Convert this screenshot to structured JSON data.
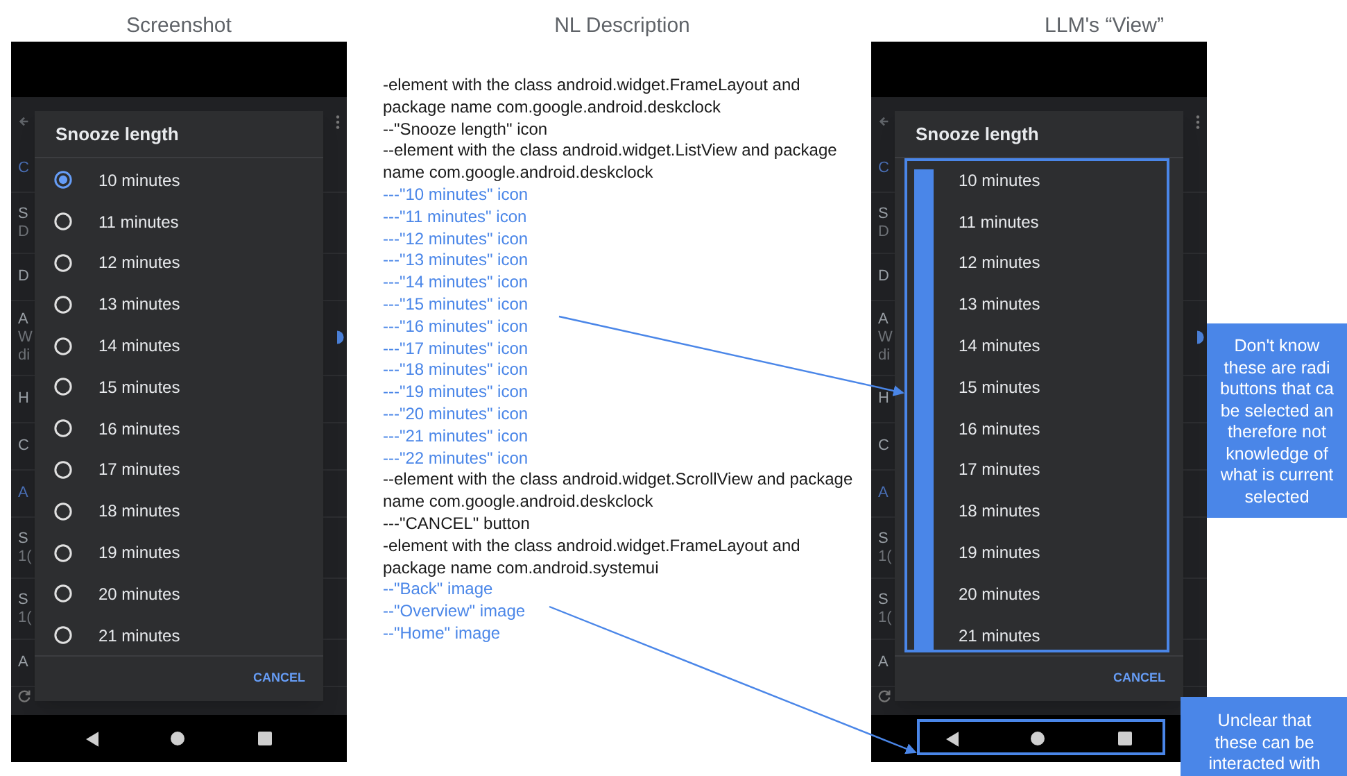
{
  "headings": [
    "Screenshot",
    "NL Description",
    "LLM's “View”"
  ],
  "phones": [
    {
      "kind": "screenshot",
      "background_rows": [
        {
          "lines": [
            "C"
          ],
          "section": true
        },
        {
          "lines": [
            "S",
            "D"
          ],
          "section": false
        },
        {
          "lines": [
            "D"
          ],
          "section": false
        },
        {
          "lines": [
            "A",
            "W",
            "di"
          ],
          "section": false
        },
        {
          "lines": [
            "H"
          ],
          "section": false
        },
        {
          "lines": [
            "C"
          ],
          "section": false
        },
        {
          "lines": [
            "A"
          ],
          "section": true
        },
        {
          "lines": [
            "S",
            "1("
          ],
          "section": false
        },
        {
          "lines": [
            "S",
            "1("
          ],
          "section": false
        },
        {
          "lines": [
            "A"
          ],
          "section": false
        }
      ],
      "dialog": {
        "title": "Snooze length",
        "options": [
          {
            "label": "10 minutes",
            "selected": true
          },
          {
            "label": "11 minutes",
            "selected": false
          },
          {
            "label": "12 minutes",
            "selected": false
          },
          {
            "label": "13 minutes",
            "selected": false
          },
          {
            "label": "14 minutes",
            "selected": false
          },
          {
            "label": "15 minutes",
            "selected": false
          },
          {
            "label": "16 minutes",
            "selected": false
          },
          {
            "label": "17 minutes",
            "selected": false
          },
          {
            "label": "18 minutes",
            "selected": false
          },
          {
            "label": "19 minutes",
            "selected": false
          },
          {
            "label": "20 minutes",
            "selected": false
          },
          {
            "label": "21 minutes",
            "selected": false
          }
        ],
        "button": "CANCEL"
      }
    },
    {
      "kind": "llm_view",
      "background_rows": [
        {
          "lines": [
            "C"
          ],
          "section": true
        },
        {
          "lines": [
            "S",
            "D"
          ],
          "section": false
        },
        {
          "lines": [
            "D"
          ],
          "section": false
        },
        {
          "lines": [
            "A",
            "W",
            "di"
          ],
          "section": false
        },
        {
          "lines": [
            "H"
          ],
          "section": false
        },
        {
          "lines": [
            "C"
          ],
          "section": false
        },
        {
          "lines": [
            "A"
          ],
          "section": true
        },
        {
          "lines": [
            "S",
            "1("
          ],
          "section": false
        },
        {
          "lines": [
            "S",
            "1("
          ],
          "section": false
        },
        {
          "lines": [
            "A"
          ],
          "section": false
        }
      ],
      "dialog": {
        "title": "Snooze length",
        "options": [
          {
            "label": "10 minutes"
          },
          {
            "label": "11 minutes"
          },
          {
            "label": "12 minutes"
          },
          {
            "label": "13 minutes"
          },
          {
            "label": "14 minutes"
          },
          {
            "label": "15 minutes"
          },
          {
            "label": "16 minutes"
          },
          {
            "label": "17 minutes"
          },
          {
            "label": "18 minutes"
          },
          {
            "label": "19 minutes"
          },
          {
            "label": "20 minutes"
          },
          {
            "label": "21 minutes"
          }
        ],
        "button": "CANCEL"
      }
    }
  ],
  "description": [
    {
      "text": "-element with the class android.widget.FrameLayout and package name com.google.android.deskclock",
      "color": "#1a1a1a"
    },
    {
      "text": "--\"Snooze length\" icon",
      "color": "#1a1a1a"
    },
    {
      "text": "--element with the class android.widget.ListView and package name com.google.android.deskclock",
      "color": "#1a1a1a"
    },
    {
      "text": "---\"10 minutes\" icon",
      "color": "#4a86e8"
    },
    {
      "text": "---\"11 minutes\" icon",
      "color": "#4a86e8"
    },
    {
      "text": "---\"12 minutes\" icon",
      "color": "#4a86e8"
    },
    {
      "text": "---\"13 minutes\" icon",
      "color": "#4a86e8"
    },
    {
      "text": "---\"14 minutes\" icon",
      "color": "#4a86e8"
    },
    {
      "text": "---\"15 minutes\" icon",
      "color": "#4a86e8"
    },
    {
      "text": "---\"16 minutes\" icon",
      "color": "#4a86e8"
    },
    {
      "text": "---\"17 minutes\" icon",
      "color": "#4a86e8"
    },
    {
      "text": "---\"18 minutes\" icon",
      "color": "#4a86e8"
    },
    {
      "text": "---\"19 minutes\" icon",
      "color": "#4a86e8"
    },
    {
      "text": "---\"20 minutes\" icon",
      "color": "#4a86e8"
    },
    {
      "text": "---\"21 minutes\" icon",
      "color": "#4a86e8"
    },
    {
      "text": "---\"22 minutes\" icon",
      "color": "#4a86e8"
    },
    {
      "text": "--element with the class android.widget.ScrollView and package name com.google.android.deskclock",
      "color": "#1a1a1a"
    },
    {
      "text": "---\"CANCEL\" button",
      "color": "#1a1a1a"
    },
    {
      "text": "-element with the class android.widget.FrameLayout and package name com.android.systemui",
      "color": "#1a1a1a"
    },
    {
      "text": "--\"Back\" image",
      "color": "#4a86e8"
    },
    {
      "text": "--\"Overview\" image",
      "color": "#4a86e8"
    },
    {
      "text": "--\"Home\" image",
      "color": "#4a86e8"
    }
  ],
  "callouts": [
    {
      "lines": [
        "Don't know",
        "these are radi",
        "buttons that ca",
        "be selected an",
        "therefore not",
        "knowledge of",
        "what is current",
        "selected"
      ]
    },
    {
      "lines": [
        "Unclear that",
        "these can be",
        "interacted with"
      ]
    }
  ]
}
